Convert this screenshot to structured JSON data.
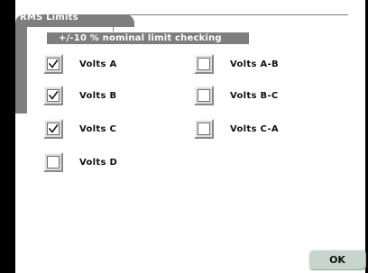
{
  "dialog": {
    "title": "RMS Limits",
    "banner": "+/-10 % nominal limit checking"
  },
  "checkboxes": [
    {
      "label": "Volts A",
      "checked": true
    },
    {
      "label": "Volts B",
      "checked": true
    },
    {
      "label": "Volts C",
      "checked": true
    },
    {
      "label": "Volts D",
      "checked": false
    },
    {
      "label": "Volts A-B",
      "checked": false
    },
    {
      "label": "Volts B-C",
      "checked": false
    },
    {
      "label": "Volts C-A",
      "checked": false
    }
  ],
  "buttons": {
    "ok_label": "OK"
  },
  "colors": {
    "frame": "#7e7e7e",
    "checkbox_face": "#dcdcdc",
    "ok_button": "#c6d6ce"
  }
}
